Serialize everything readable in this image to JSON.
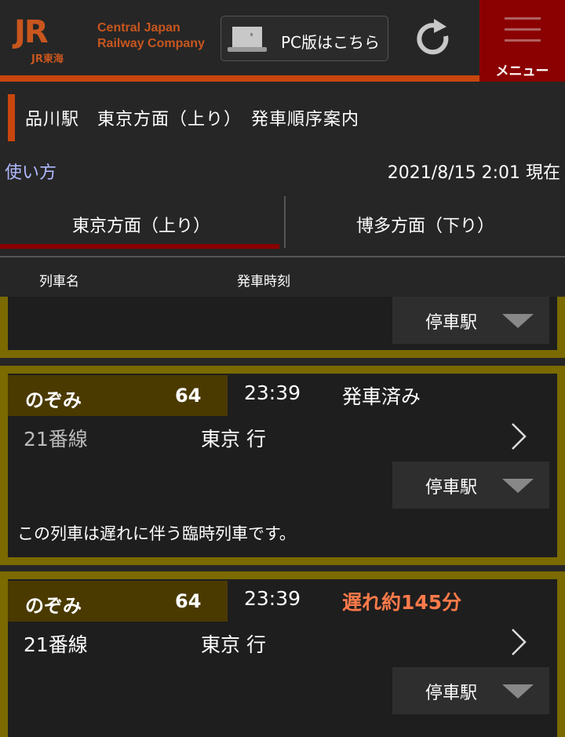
{
  "header": {
    "logo_text": "JR",
    "logo_sub": "JR東海",
    "company_line1": "Central Japan",
    "company_line2": "Railway Company",
    "pc_button_label": "PC版はこちら",
    "menu_label": "メニュー"
  },
  "page": {
    "title": "品川駅　東京方面（上り）　発車順序案内",
    "howto_link": "使い方",
    "timestamp": "2021/8/15 2:01 現在"
  },
  "tabs": [
    {
      "label": "東京方面（上り）",
      "active": true
    },
    {
      "label": "博多方面（下り）",
      "active": false
    }
  ],
  "columns": {
    "train_name": "列車名",
    "departure_time": "発車時刻"
  },
  "stops_label": "停車駅",
  "trains": [
    {
      "name": "のぞみ",
      "number": "64",
      "time": "23:39",
      "status": "発車済み",
      "status_color": "#ffffff",
      "track": "21番線",
      "destination": "東京 行",
      "note": "この列車は遅れに伴う臨時列車です。"
    },
    {
      "name": "のぞみ",
      "number": "64",
      "time": "23:39",
      "status": "遅れ約145分",
      "status_color": "#ff7a4a",
      "track": "21番線",
      "destination": "東京 行"
    }
  ],
  "colors": {
    "accent_orange": "#c8460e",
    "menu_red": "#8b0000",
    "card_border": "#7a6a00",
    "delay_text": "#ff7a4a"
  }
}
